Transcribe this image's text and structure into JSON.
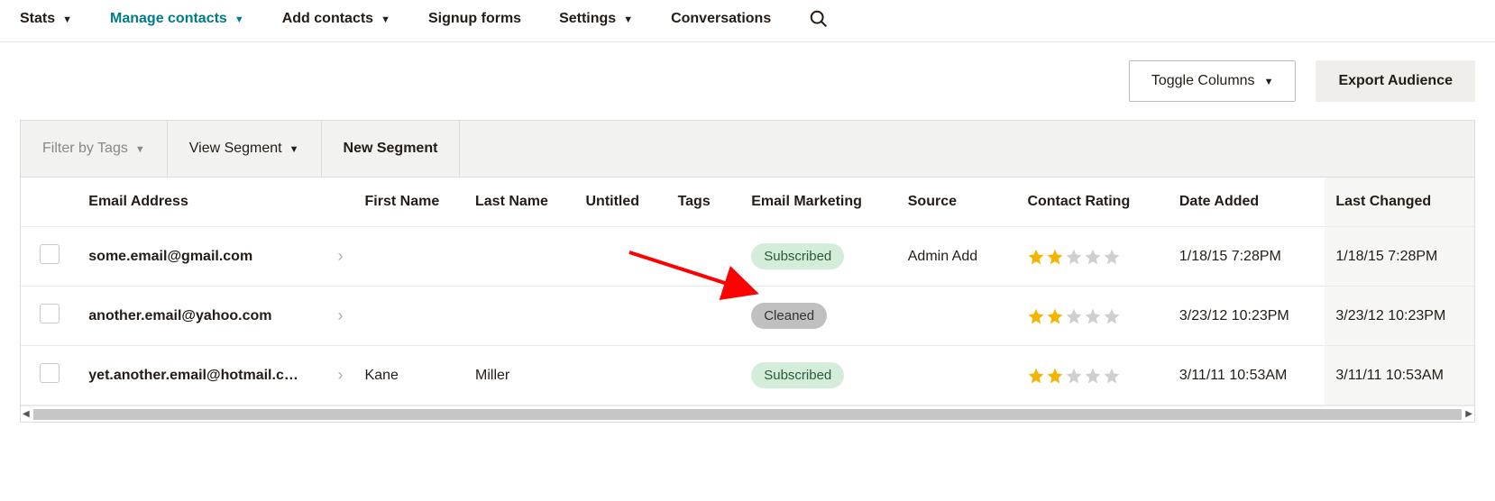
{
  "nav": {
    "stats": "Stats",
    "manage": "Manage contacts",
    "add": "Add contacts",
    "signup": "Signup forms",
    "settings": "Settings",
    "conversations": "Conversations"
  },
  "actions": {
    "toggle": "Toggle Columns",
    "export": "Export Audience"
  },
  "filter": {
    "tags": "Filter by Tags",
    "view": "View Segment",
    "new": "New Segment"
  },
  "columns": {
    "email": "Email Address",
    "first": "First Name",
    "last": "Last Name",
    "untitled": "Untitled",
    "tags": "Tags",
    "marketing": "Email Marketing",
    "source": "Source",
    "rating": "Contact Rating",
    "added": "Date Added",
    "changed": "Last Changed"
  },
  "rows": [
    {
      "email": "some.email@gmail.com",
      "first": "",
      "last": "",
      "untitled": "",
      "tags": "",
      "marketing": "Subscribed",
      "marketing_kind": "sub",
      "source": "Admin Add",
      "rating": 2,
      "added": "1/18/15 7:28PM",
      "changed": "1/18/15 7:28PM"
    },
    {
      "email": "another.email@yahoo.com",
      "first": "",
      "last": "",
      "untitled": "",
      "tags": "",
      "marketing": "Cleaned",
      "marketing_kind": "clean",
      "source": "",
      "rating": 2,
      "added": "3/23/12 10:23PM",
      "changed": "3/23/12 10:23PM"
    },
    {
      "email": "yet.another.email@hotmail.com",
      "first": "Kane",
      "last": "Miller",
      "untitled": "",
      "tags": "",
      "marketing": "Subscribed",
      "marketing_kind": "sub",
      "source": "",
      "rating": 2,
      "added": "3/11/11 10:53AM",
      "changed": "3/11/11 10:53AM"
    }
  ],
  "annotation": {
    "arrow_color": "#ff0000",
    "arrow_target": "cleaned-badge"
  }
}
